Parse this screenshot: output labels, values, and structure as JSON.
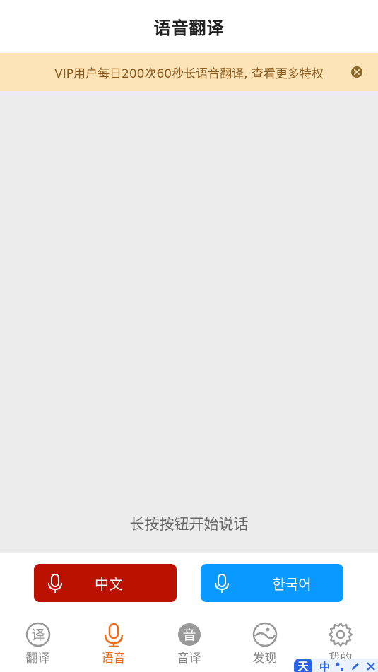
{
  "header": {
    "title": "语音翻译"
  },
  "banner": {
    "text": "VIP用户每日200次60秒长语音翻译, 查看更多特权"
  },
  "content": {
    "hint": "长按按钮开始说话"
  },
  "languages": {
    "source": "中文",
    "target": "한국어"
  },
  "tabs": [
    {
      "label": "翻译",
      "icon_text": "译"
    },
    {
      "label": "语音"
    },
    {
      "label": "音译",
      "icon_text": "音"
    },
    {
      "label": "发现"
    },
    {
      "label": "我的"
    }
  ],
  "ime": {
    "logo": "天",
    "lang": "中"
  },
  "colors": {
    "accent": "#f06a1a",
    "source_button": "#bb1100",
    "target_button": "#0a99ff",
    "banner_bg": "#fde3b8",
    "banner_text": "#8a5a1c"
  }
}
